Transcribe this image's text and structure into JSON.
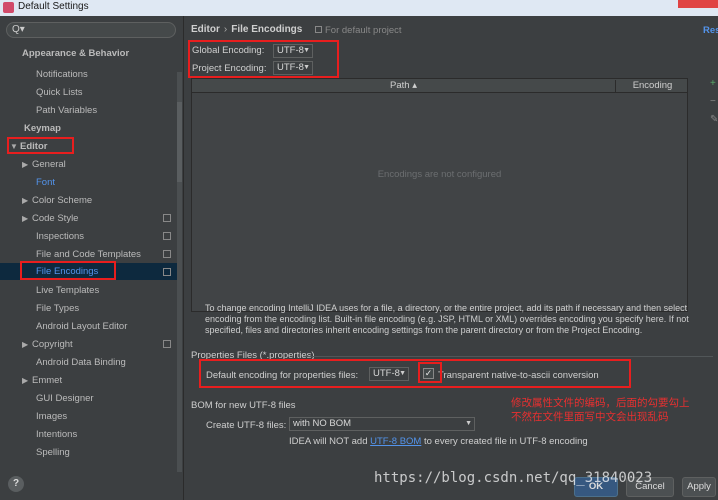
{
  "window": {
    "title": "Default Settings"
  },
  "search": {
    "placeholder": "Q▾"
  },
  "sidebar": {
    "items": [
      {
        "label": "Appearance & Behavior"
      },
      {
        "label": "Notifications"
      },
      {
        "label": "Quick Lists"
      },
      {
        "label": "Path Variables"
      },
      {
        "label": "Keymap"
      },
      {
        "label": "Editor"
      },
      {
        "label": "General"
      },
      {
        "label": "Font"
      },
      {
        "label": "Color Scheme"
      },
      {
        "label": "Code Style"
      },
      {
        "label": "Inspections"
      },
      {
        "label": "File and Code Templates"
      },
      {
        "label": "File Encodings"
      },
      {
        "label": "Live Templates"
      },
      {
        "label": "File Types"
      },
      {
        "label": "Android Layout Editor"
      },
      {
        "label": "Copyright"
      },
      {
        "label": "Android Data Binding"
      },
      {
        "label": "Emmet"
      },
      {
        "label": "GUI Designer"
      },
      {
        "label": "Images"
      },
      {
        "label": "Intentions"
      },
      {
        "label": "Spelling"
      }
    ]
  },
  "header": {
    "crumb1": "Editor",
    "crumb2": "File Encodings",
    "for_default": "For default project",
    "reset": "Res"
  },
  "encodings": {
    "global_label": "Global Encoding:",
    "global_value": "UTF-8",
    "project_label": "Project Encoding:",
    "project_value": "UTF-8"
  },
  "table": {
    "col_path": "Path ▴",
    "col_encoding": "Encoding",
    "empty_text": "Encodings are not configured"
  },
  "description": "To change encoding IntelliJ IDEA uses for a file, a directory, or the entire project, add its path if necessary and then select encoding from the encoding list. Built-in file encoding (e.g. JSP, HTML or XML) overrides encoding you specify here. If not specified, files and directories inherit encoding settings from the parent directory or from the Project Encoding.",
  "properties": {
    "section_title": "Properties Files (*.properties)",
    "default_label": "Default encoding for properties files:",
    "default_value": "UTF-8",
    "transparent_label": "Transparent native-to-ascii conversion",
    "transparent_checked": true
  },
  "annotation": {
    "line1": "修改属性文件的编码，后面的勾要勾上",
    "line2": "不然在文件里面写中文会出现乱码"
  },
  "bom": {
    "section_title": "BOM for new UTF-8 files",
    "create_label": "Create UTF-8 files:",
    "create_value": "with NO BOM",
    "info_prefix": "IDEA will NOT add",
    "info_link": "UTF-8 BOM",
    "info_suffix": "to every created file in UTF-8 encoding"
  },
  "buttons": {
    "ok": "OK",
    "cancel": "Cancel",
    "apply": "Apply",
    "help": "?"
  },
  "watermark": "https://blog.csdn.net/qq_31840023",
  "colors": {
    "accent": "#5394ec",
    "highlight_box": "#e81e1e",
    "selection": "#0d293e"
  }
}
